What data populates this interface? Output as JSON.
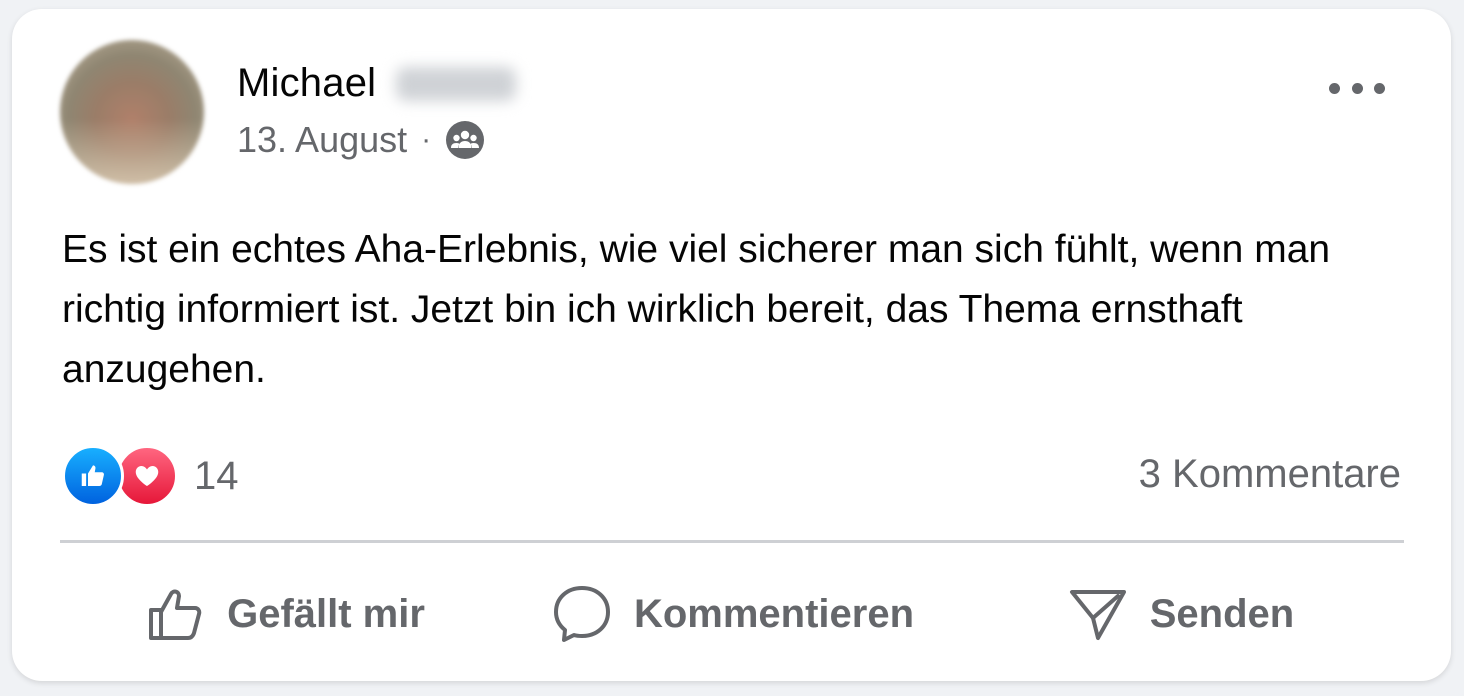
{
  "post": {
    "author_first_name": "Michael",
    "date": "13. August",
    "separator": "·",
    "audience_icon": "friends-group-icon",
    "more_icon": "more-horizontal-icon",
    "text": "Es ist ein echtes Aha-Erlebnis, wie viel sicherer man sich fühlt, wenn man richtig informiert ist. Jetzt bin ich wirklich bereit, das Thema ernsthaft anzugehen."
  },
  "reactions": {
    "types": [
      "like",
      "love"
    ],
    "count": "14",
    "comments": "3 Kommentare"
  },
  "actions": {
    "like_label": "Gefällt mir",
    "comment_label": "Kommentieren",
    "send_label": "Senden"
  },
  "colors": {
    "text_primary": "#050505",
    "text_secondary": "#65676b",
    "like_blue": "#0866ff",
    "love_red": "#f33e58",
    "divider": "#ced0d4"
  }
}
